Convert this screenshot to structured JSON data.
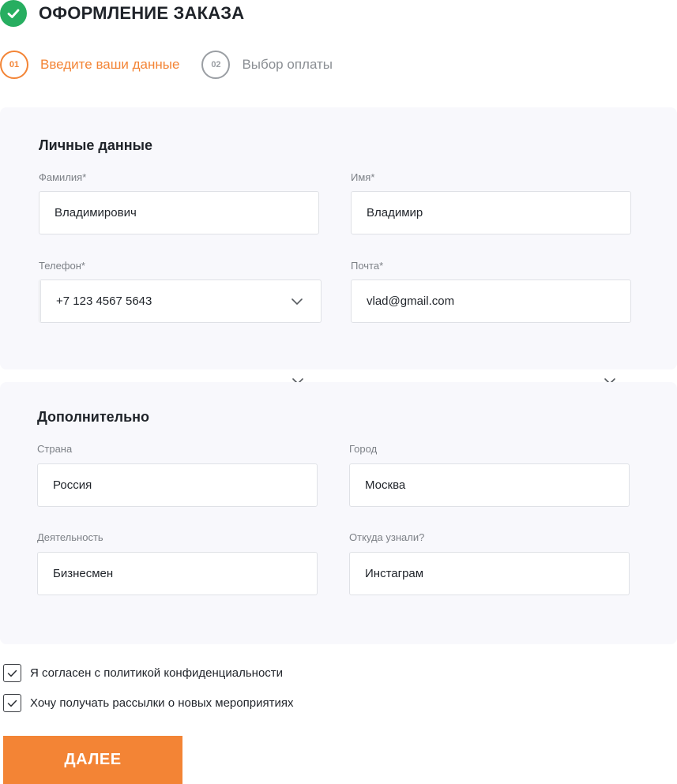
{
  "header": {
    "title": "ОФОРМЛЕНИЕ ЗАКАЗА",
    "status_icon": "check-icon",
    "status_color": "#27ae60"
  },
  "steps": [
    {
      "num": "01",
      "label": "Введите ваши данные",
      "state": "active"
    },
    {
      "num": "02",
      "label": "Выбор оплаты",
      "state": "inactive"
    }
  ],
  "accent_color": "#f38435",
  "personal": {
    "title": "Личные данные",
    "surname": {
      "label": "Фамилия*",
      "value": "Владимирович"
    },
    "name": {
      "label": "Имя*",
      "value": "Владимир"
    },
    "phone": {
      "label": "Телефон*",
      "value": "+7 123 4567 5643",
      "icon": "chevron-down-icon"
    },
    "email": {
      "label": "Почта*",
      "value": "vlad@gmail.com"
    }
  },
  "extra": {
    "title": "Дополнительно",
    "country": {
      "label": "Страна",
      "value": "Россия"
    },
    "city": {
      "label": "Город",
      "value": "Москва"
    },
    "activity": {
      "label": "Деятельность",
      "value": "Бизнесмен"
    },
    "source": {
      "label": "Откуда узнали?",
      "value": "Инстаграм"
    }
  },
  "consents": [
    {
      "label": "Я согласен с политикой конфиденциальности",
      "checked": true
    },
    {
      "label": "Хочу получать рассылки о новых мероприятиях",
      "checked": true
    }
  ],
  "actions": {
    "next_label": "ДАЛЕЕ"
  }
}
